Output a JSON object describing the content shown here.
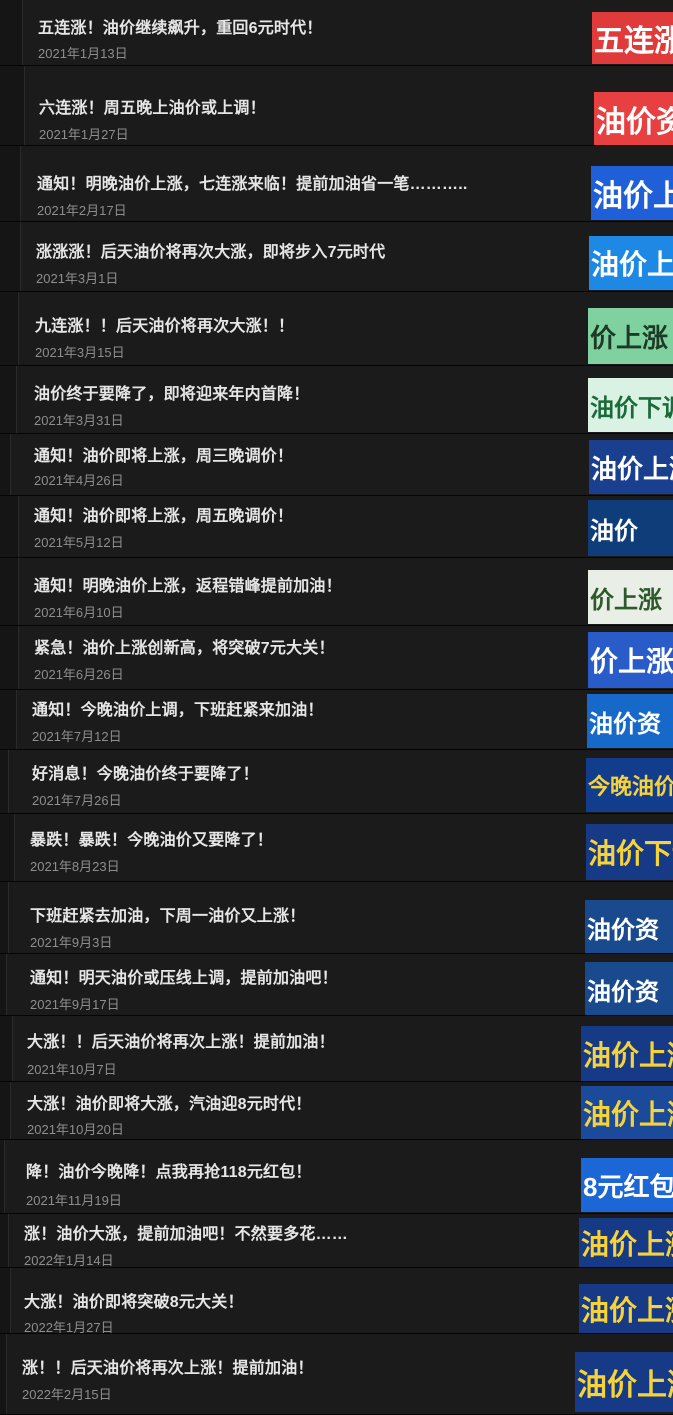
{
  "articles": [
    {
      "title": "五连涨！油价继续飙升，重回6元时代！",
      "date": "2021年1月13日",
      "thumb_text": "五连涨",
      "thumb_bg": "#e03b3b",
      "thumb_fg": "#ffffff"
    },
    {
      "title": "六连涨！周五晚上油价或上调！",
      "date": "2021年1月27日",
      "thumb_text": "油价资讯",
      "thumb_bg": "#e84040",
      "thumb_fg": "#ffffff"
    },
    {
      "title": "通知！明晚油价上涨，七连涨来临！提前加油省一笔………..",
      "date": "2021年2月17日",
      "thumb_text": "油价上",
      "thumb_bg": "#1f5fd8",
      "thumb_fg": "#ffffff"
    },
    {
      "title": "涨涨涨！后天油价将再次大涨，即将步入7元时代",
      "date": "2021年3月1日",
      "thumb_text": "油价上涨",
      "thumb_bg": "#1e88e5",
      "thumb_fg": "#ffffff"
    },
    {
      "title": "九连涨！！后天油价将再次大涨！！",
      "date": "2021年3月15日",
      "thumb_text": "价上涨",
      "thumb_bg": "#7fd1a0",
      "thumb_fg": "#1d3a26"
    },
    {
      "title": "油价终于要降了，即将迎来年内首降！",
      "date": "2021年3月31日",
      "thumb_text": "油价下调",
      "thumb_bg": "#d9f2e4",
      "thumb_fg": "#1b6b3a"
    },
    {
      "title": "通知！油价即将上涨，周三晚调价！",
      "date": "2021年4月26日",
      "thumb_text": "油价上涨",
      "thumb_bg": "#1a3f8f",
      "thumb_fg": "#ffffff"
    },
    {
      "title": "通知！油价即将上涨，周五晚调价！",
      "date": "2021年5月12日",
      "thumb_text": "油价",
      "thumb_bg": "#0e3d7a",
      "thumb_fg": "#ffffff"
    },
    {
      "title": "通知！明晚油价上涨，返程错峰提前加油！",
      "date": "2021年6月10日",
      "thumb_text": "价上涨",
      "thumb_bg": "#e9efe6",
      "thumb_fg": "#2d5a2a"
    },
    {
      "title": "紧急！油价上涨创新高，将突破7元大关！",
      "date": "2021年6月26日",
      "thumb_text": "价上涨",
      "thumb_bg": "#2a5cc9",
      "thumb_fg": "#ffffff"
    },
    {
      "title": "通知！今晚油价上调，下班赶紧来加油！",
      "date": "2021年7月12日",
      "thumb_text": "油价资",
      "thumb_bg": "#1669c8",
      "thumb_fg": "#ffffff"
    },
    {
      "title": "好消息！今晚油价终于要降了！",
      "date": "2021年7月26日",
      "thumb_text": "今晚油价下",
      "thumb_bg": "#123d8c",
      "thumb_fg": "#f6d33a"
    },
    {
      "title": "暴跌！暴跌！今晚油价又要降了！",
      "date": "2021年8月23日",
      "thumb_text": "油价下调",
      "thumb_bg": "#163a86",
      "thumb_fg": "#f6d33a"
    },
    {
      "title": "下班赶紧去加油，下周一油价又上涨！",
      "date": "2021年9月3日",
      "thumb_text": "油价资",
      "thumb_bg": "#1a4a8e",
      "thumb_fg": "#ffffff"
    },
    {
      "title": "通知！明天油价或压线上调，提前加油吧！",
      "date": "2021年9月17日",
      "thumb_text": "油价资",
      "thumb_bg": "#1a4a8e",
      "thumb_fg": "#ffffff"
    },
    {
      "title": "大涨！！后天油价将再次上涨！提前加油！",
      "date": "2021年10月7日",
      "thumb_text": "油价上涨",
      "thumb_bg": "#163a86",
      "thumb_fg": "#f6d33a"
    },
    {
      "title": "大涨！油价即将大涨，汽油迎8元时代！",
      "date": "2021年10月20日",
      "thumb_text": "油价上涨",
      "thumb_bg": "#1c4a9a",
      "thumb_fg": "#f6d33a"
    },
    {
      "title": "降！油价今晚降！点我再抢118元红包！",
      "date": "2021年11月19日",
      "thumb_text": "8元红包!",
      "thumb_bg": "#1d66d6",
      "thumb_fg": "#ffffff"
    },
    {
      "title": "涨！油价大涨，提前加油吧！不然要多花……",
      "date": "2022年1月14日",
      "thumb_text": "油价上涨",
      "thumb_bg": "#163a86",
      "thumb_fg": "#f6d33a"
    },
    {
      "title": "大涨！油价即将突破8元大关！",
      "date": "2022年1月27日",
      "thumb_text": "油价上涨",
      "thumb_bg": "#163a86",
      "thumb_fg": "#f6d33a"
    },
    {
      "title": "涨！！后天油价将再次上涨！提前加油！",
      "date": "2022年2月15日",
      "thumb_text": "油价上涨",
      "thumb_bg": "#163a86",
      "thumb_fg": "#f6d33a"
    }
  ]
}
